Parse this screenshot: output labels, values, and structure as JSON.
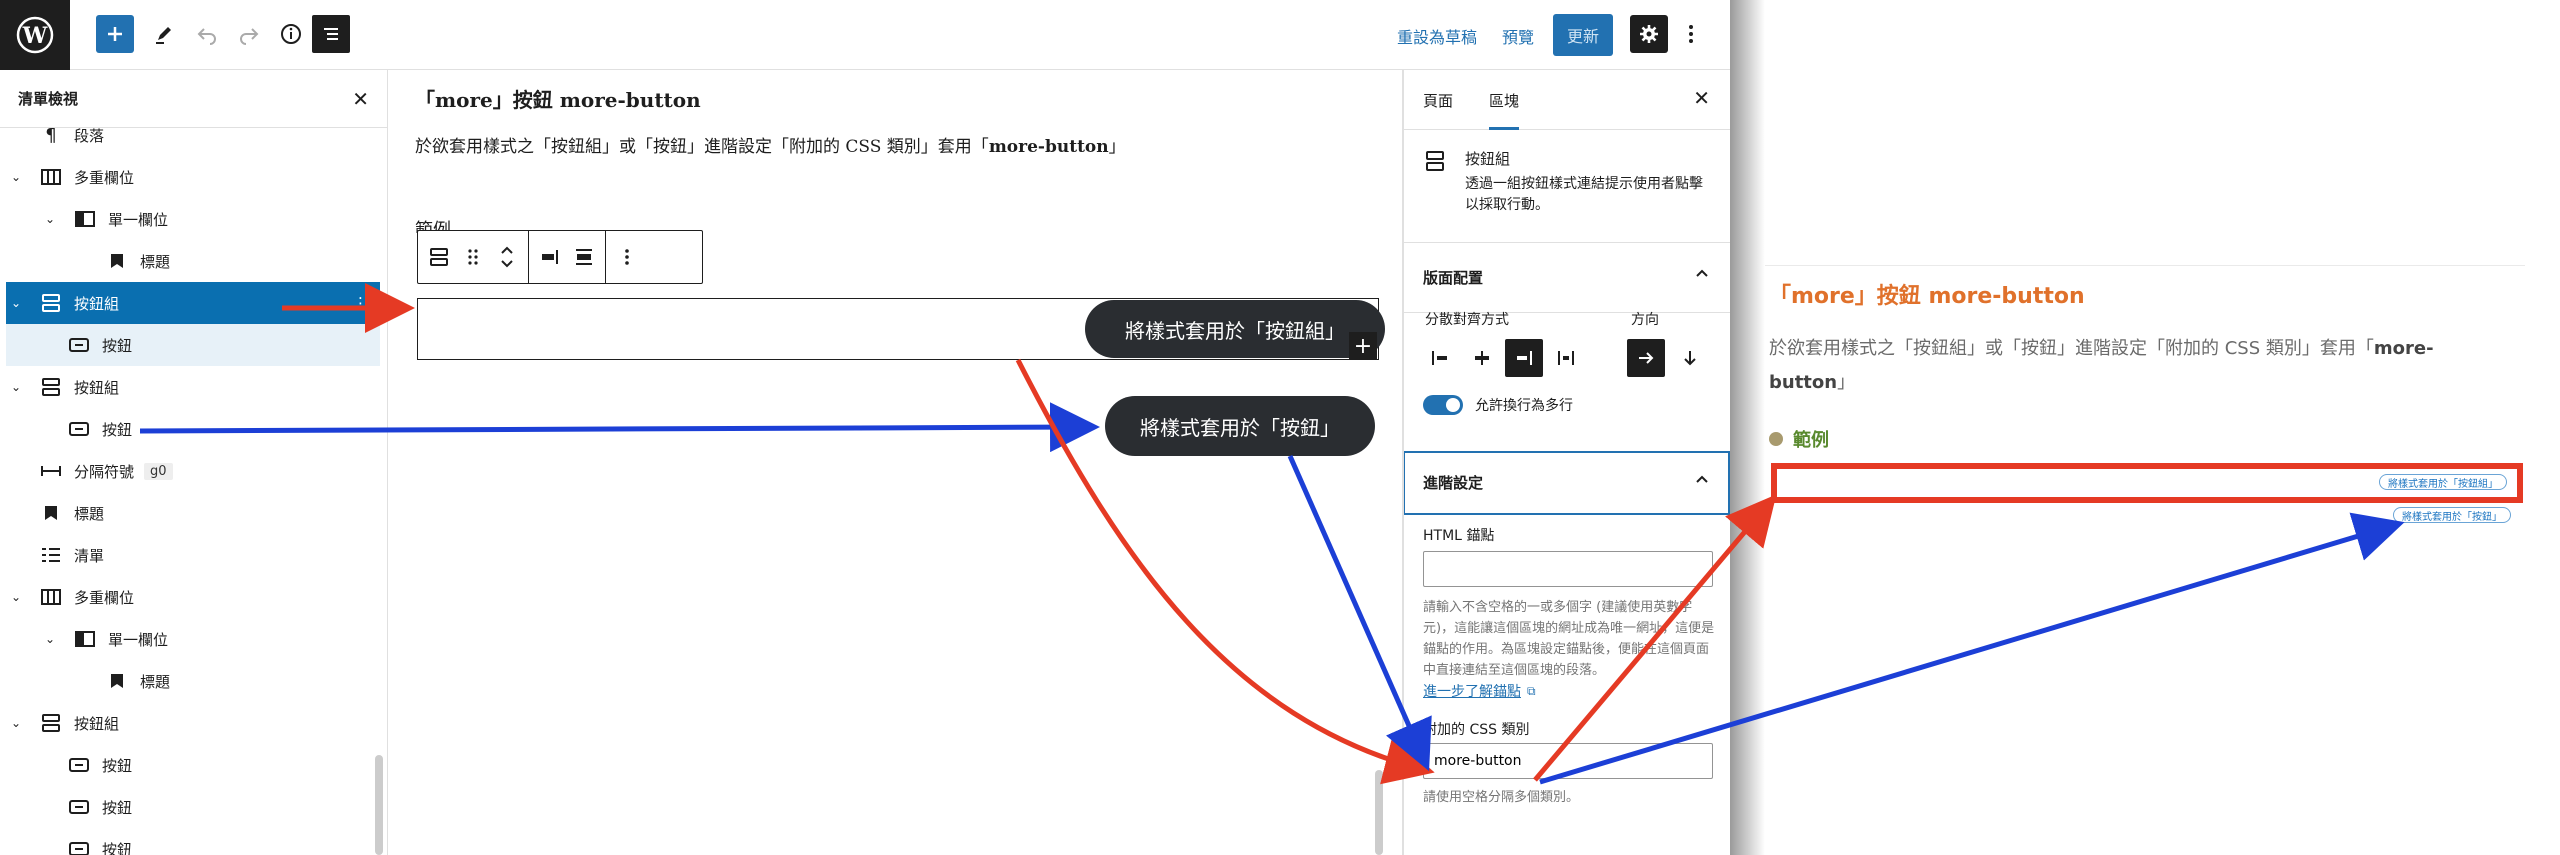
{
  "topbar": {
    "revert_label": "重設為草稿",
    "preview_label": "預覽",
    "update_label": "更新"
  },
  "listview": {
    "title": "清單檢視",
    "rows": [
      {
        "label": "段落"
      },
      {
        "label": "多重欄位"
      },
      {
        "label": "單一欄位"
      },
      {
        "label": "標題"
      },
      {
        "label": "按鈕組"
      },
      {
        "label": "按鈕"
      },
      {
        "label": "按鈕組"
      },
      {
        "label": "按鈕"
      },
      {
        "label": "分隔符號",
        "tag": "g0"
      },
      {
        "label": "標題"
      },
      {
        "label": "清單"
      },
      {
        "label": "多重欄位"
      },
      {
        "label": "單一欄位"
      },
      {
        "label": "標題"
      },
      {
        "label": "按鈕組"
      },
      {
        "label": "按鈕"
      },
      {
        "label": "按鈕"
      },
      {
        "label": "按鈕"
      }
    ]
  },
  "canvas": {
    "heading": "「more」按鈕 more-button",
    "para_pre": "於欲套用樣式之「按鈕組」或「按鈕」進階設定「附加的 CSS 類別」套用「",
    "para_bold": "more-button",
    "para_post": "」",
    "sub": "範例",
    "pill_group": "將樣式套用於「按鈕組」",
    "pill_button": "將樣式套用於「按鈕」"
  },
  "sidebar": {
    "tab_page": "頁面",
    "tab_block": "區塊",
    "block_title": "按鈕組",
    "block_desc": "透過一組按鈕樣式連結提示使用者點擊以採取行動。",
    "layout_title": "版面配置",
    "justify_label": "分散對齊方式",
    "orientation_label": "方向",
    "wrap_label": "允許換行為多行",
    "advanced_title": "進階設定",
    "html_anchor_label": "HTML 錨點",
    "html_anchor_value": "",
    "anchor_help": "請輸入不含空格的一或多個字 (建議使用英數字元)，這能讓這個區塊的網址成為唯一網址，這便是錨點的作用。為區塊設定錨點後，便能在這個頁面中直接連結至這個區塊的段落。",
    "anchor_link": "進一步了解錨點",
    "css_label": "附加的 CSS 類別",
    "css_value": "more-button",
    "css_help": "請使用空格分隔多個類別。"
  },
  "preview": {
    "heading": "「more」按鈕 more-button",
    "para_pre": "於欲套用樣式之「按鈕組」或「按鈕」進階設定「附加的 CSS 類別」套用「",
    "para_bold": "more-button",
    "para_post": "」",
    "sub": "範例",
    "btn_group": "將樣式套用於「按鈕組」",
    "btn_button": "將樣式套用於「按鈕」"
  },
  "colors": {
    "accent": "#2271b1",
    "selection": "#0a6fb0",
    "arrow_red": "#e53a24",
    "arrow_blue": "#1c3fd6",
    "preview_heading": "#e0712b",
    "preview_sub": "#5a8a2f"
  }
}
